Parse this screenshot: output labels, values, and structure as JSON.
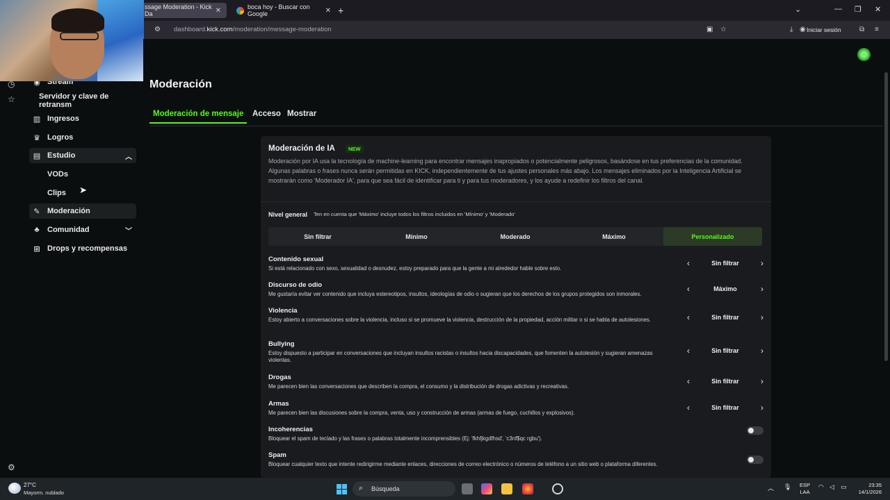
{
  "browser": {
    "tabs": [
      {
        "title": "ssage Moderation - Kick Da",
        "active": true
      },
      {
        "title": "boca hoy - Buscar con Google",
        "active": false
      }
    ],
    "url_prefix": "dashboard.",
    "url_domain": "kick.com",
    "url_path": "/moderation/message-moderation",
    "signin_label": "Iniciar sesión"
  },
  "sidebar": {
    "items": [
      {
        "label": "Stream",
        "icon": "stream-icon"
      },
      {
        "label": "Servidor y clave de retransm",
        "icon": ""
      },
      {
        "label": "Ingresos",
        "icon": "bar-chart-icon"
      },
      {
        "label": "Logros",
        "icon": "trophy-icon"
      },
      {
        "label": "Estudio",
        "icon": "studio-icon",
        "expanded": true
      },
      {
        "label": "VODs",
        "icon": ""
      },
      {
        "label": "Clips",
        "icon": ""
      },
      {
        "label": "Moderación",
        "icon": "wrench-icon",
        "active": true
      },
      {
        "label": "Comunidad",
        "icon": "community-icon",
        "expanded": false
      },
      {
        "label": "Drops y recompensas",
        "icon": "drops-icon"
      }
    ]
  },
  "main": {
    "title": "Moderación",
    "tabs": [
      "Moderación de mensaje",
      "Acceso",
      "Mostrar"
    ],
    "active_tab": "Moderación de mensaje"
  },
  "ai_panel": {
    "title": "Moderación de IA",
    "badge": "NEW",
    "description": "Moderación por IA usa la tecnología de machine-learning para encontrar mensajes inapropiados o potencialmente peligrosos, basándose en tus preferencias de la comunidad. Algunas palabras o frases nunca serán permitidas en KICK, independientemente de tus ajustes personales más abajo. Los mensajes eliminados por la Inteligencia Artificial se mostrarán como 'Moderador IA', para que sea fácil de identificar para ti y para tus moderadores, y los ayude a redefinir los filtros del canal.",
    "level_label": "Nivel general",
    "level_note": "Ten en cuenta que 'Máximo' incluye todos los filtros incluidos en 'Mínimo' y 'Moderado'",
    "levels": [
      "Sin filtrar",
      "Mínimo",
      "Moderado",
      "Máximo",
      "Personalizado"
    ],
    "selected_level": "Personalizado",
    "categories": [
      {
        "name": "Contenido sexual",
        "desc": "Si está relacionado con sexo, sexualidad o desnudez, estoy preparado para que la gente a mi alrededor hable sobre esto.",
        "value": "Sin filtrar"
      },
      {
        "name": "Discurso de odio",
        "desc": "Me gustaría evitar ver contenido que incluya estereotipos, insultos, ideologías de odio o sugieran que los derechos de los grupos protegidos son inmorales.",
        "value": "Máximo"
      },
      {
        "name": "Violencia",
        "desc": "Estoy abierto a conversaciones sobre la violencia, incluso si se promueve la violencia, destrucción de la propiedad, acción militar o si se habla de autolesiones.",
        "value": "Sin filtrar"
      },
      {
        "name": "Bullying",
        "desc": "Estoy dispuesto a participar en conversaciones que incluyan insultos racistas o insultos hacia discapacidades, que fomenten la autolesión y sugieran amenazas violentas.",
        "value": "Sin filtrar"
      },
      {
        "name": "Drogas",
        "desc": "Me parecen bien las conversaciones que describen la compra, el consumo y la distribución de drogas adictivas y recreativas.",
        "value": "Sin filtrar"
      },
      {
        "name": "Armas",
        "desc": "Me parecen bien las discusiones sobre la compra, venta, uso y construcción de armas (armas de fuego, cuchillos y explosivos).",
        "value": "Sin filtrar"
      }
    ],
    "toggles": [
      {
        "name": "Incoherencias",
        "desc": "Bloquear el spam de teclado y las frases o palabras totalmente incomprensibles (Ej: 'fkhfjkgdfhsd', 'c3nf$qc rgbu').",
        "enabled": false
      },
      {
        "name": "Spam",
        "desc": "Bloquear cualquier texto que intente redirigirme mediante enlaces, direcciones de correo electrónico o números de teléfono a un sitio web o plataforma diferentes.",
        "enabled": false
      }
    ]
  },
  "taskbar": {
    "temperature": "27°C",
    "weather": "Mayorm. nublado",
    "search_placeholder": "Búsqueda",
    "lang_top": "ESP",
    "lang_bottom": "LAA",
    "time": "23:35",
    "date": "14/1/2026"
  },
  "colors": {
    "accent": "#53fc18",
    "background": "#0b0e0f",
    "panel": "#191b1f"
  }
}
